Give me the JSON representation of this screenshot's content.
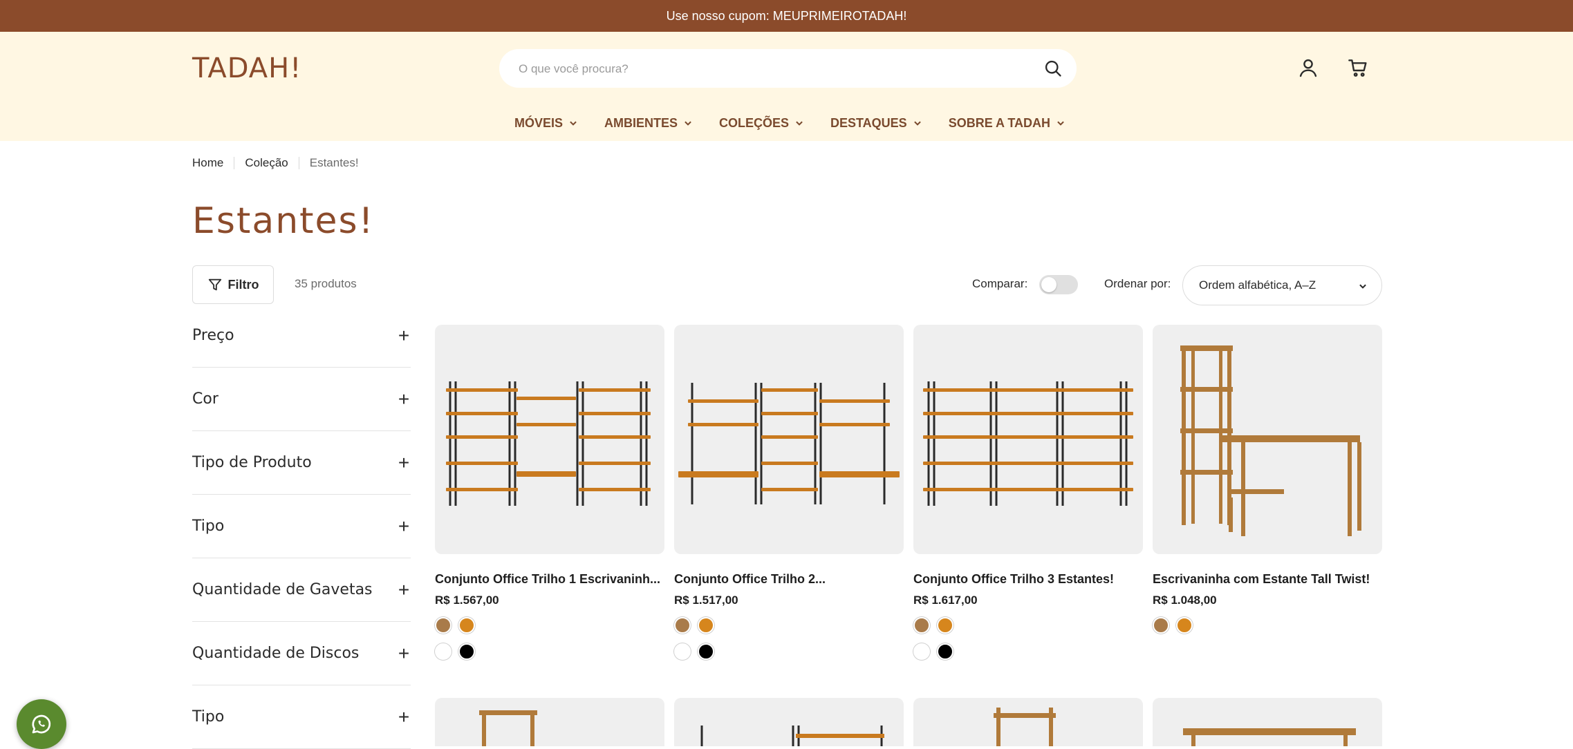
{
  "announcement": "Use nosso cupom: MEUPRIMEIROTADAH!",
  "logo": "TADAH!",
  "search": {
    "placeholder": "O que você procura?"
  },
  "nav": [
    "MÓVEIS",
    "AMBIENTES",
    "COLEÇÕES",
    "DESTAQUES",
    "SOBRE A TADAH"
  ],
  "breadcrumb": [
    "Home",
    "Coleção",
    "Estantes!"
  ],
  "page_title": "Estantes!",
  "toolbar": {
    "filter_label": "Filtro",
    "count": "35 produtos",
    "compare_label": "Comparar:",
    "compare_on": false,
    "sort_label": "Ordenar por:",
    "sort_value": "Ordem alfabética, A–Z"
  },
  "facets": [
    "Preço",
    "Cor",
    "Tipo de Produto",
    "Tipo",
    "Quantidade de Gavetas",
    "Quantidade de Discos",
    "Tipo"
  ],
  "products": [
    {
      "name": "Conjunto Office Trilho 1 Escrivaninh...",
      "price": "R$ 1.567,00",
      "swatches": [
        [
          "#a97b4a",
          "#d6861d"
        ],
        [
          "#ffffff",
          "#000000"
        ]
      ]
    },
    {
      "name": "Conjunto Office Trilho 2...",
      "price": "R$ 1.517,00",
      "swatches": [
        [
          "#a97b4a",
          "#d6861d"
        ],
        [
          "#ffffff",
          "#000000"
        ]
      ]
    },
    {
      "name": "Conjunto Office Trilho 3 Estantes!",
      "price": "R$ 1.617,00",
      "swatches": [
        [
          "#a97b4a",
          "#d6861d"
        ],
        [
          "#ffffff",
          "#000000"
        ]
      ]
    },
    {
      "name": "Escrivaninha com Estante Tall Twist!",
      "price": "R$ 1.048,00",
      "swatches": [
        [
          "#a97b4a",
          "#d6861d"
        ]
      ]
    }
  ],
  "icons": {
    "search": "search-icon",
    "account": "user-icon",
    "cart": "cart-icon",
    "filter": "filter-icon",
    "whatsapp": "whatsapp-icon"
  },
  "colors": {
    "announcement_bg": "#8b4b2b",
    "header_bg": "#fff7e3",
    "brand": "#8b4b2b",
    "whatsapp": "#5a8a2e"
  }
}
